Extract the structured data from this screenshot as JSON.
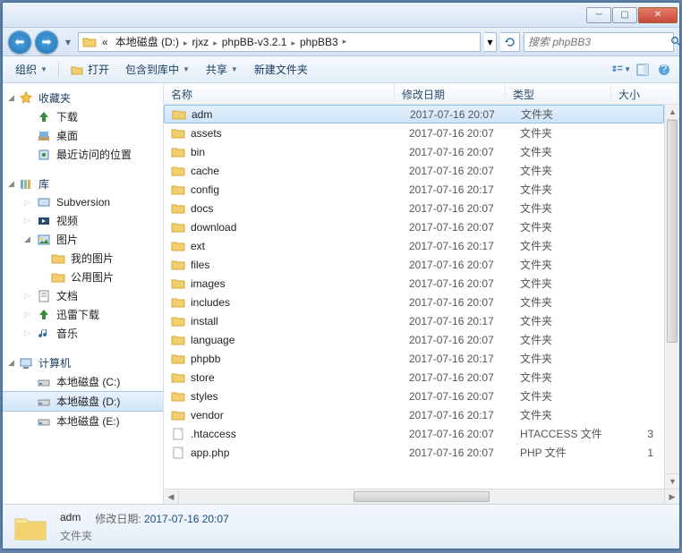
{
  "breadcrumb": {
    "prefix": "«",
    "items": [
      "本地磁盘 (D:)",
      "rjxz",
      "phpBB-v3.2.1",
      "phpBB3"
    ]
  },
  "search": {
    "placeholder": "搜索 phpBB3"
  },
  "toolbar": {
    "organize": "组织",
    "open": "打开",
    "include": "包含到库中",
    "share": "共享",
    "newfolder": "新建文件夹"
  },
  "columns": {
    "name": "名称",
    "date": "修改日期",
    "type": "类型",
    "size": "大小"
  },
  "nav": {
    "favorites": {
      "label": "收藏夹",
      "items": [
        "下载",
        "桌面",
        "最近访问的位置"
      ]
    },
    "libraries": {
      "label": "库",
      "items": [
        {
          "label": "Subversion"
        },
        {
          "label": "视频"
        },
        {
          "label": "图片",
          "children": [
            "我的图片",
            "公用图片"
          ]
        },
        {
          "label": "文档"
        },
        {
          "label": "迅雷下载"
        },
        {
          "label": "音乐"
        }
      ]
    },
    "computer": {
      "label": "计算机",
      "items": [
        "本地磁盘 (C:)",
        "本地磁盘 (D:)",
        "本地磁盘 (E:)"
      ]
    }
  },
  "files": [
    {
      "name": "adm",
      "date": "2017-07-16 20:07",
      "type": "文件夹",
      "kind": "folder",
      "selected": true
    },
    {
      "name": "assets",
      "date": "2017-07-16 20:07",
      "type": "文件夹",
      "kind": "folder"
    },
    {
      "name": "bin",
      "date": "2017-07-16 20:07",
      "type": "文件夹",
      "kind": "folder"
    },
    {
      "name": "cache",
      "date": "2017-07-16 20:07",
      "type": "文件夹",
      "kind": "folder"
    },
    {
      "name": "config",
      "date": "2017-07-16 20:17",
      "type": "文件夹",
      "kind": "folder"
    },
    {
      "name": "docs",
      "date": "2017-07-16 20:07",
      "type": "文件夹",
      "kind": "folder"
    },
    {
      "name": "download",
      "date": "2017-07-16 20:07",
      "type": "文件夹",
      "kind": "folder"
    },
    {
      "name": "ext",
      "date": "2017-07-16 20:17",
      "type": "文件夹",
      "kind": "folder"
    },
    {
      "name": "files",
      "date": "2017-07-16 20:07",
      "type": "文件夹",
      "kind": "folder"
    },
    {
      "name": "images",
      "date": "2017-07-16 20:07",
      "type": "文件夹",
      "kind": "folder"
    },
    {
      "name": "includes",
      "date": "2017-07-16 20:07",
      "type": "文件夹",
      "kind": "folder"
    },
    {
      "name": "install",
      "date": "2017-07-16 20:17",
      "type": "文件夹",
      "kind": "folder"
    },
    {
      "name": "language",
      "date": "2017-07-16 20:07",
      "type": "文件夹",
      "kind": "folder"
    },
    {
      "name": "phpbb",
      "date": "2017-07-16 20:17",
      "type": "文件夹",
      "kind": "folder"
    },
    {
      "name": "store",
      "date": "2017-07-16 20:07",
      "type": "文件夹",
      "kind": "folder"
    },
    {
      "name": "styles",
      "date": "2017-07-16 20:07",
      "type": "文件夹",
      "kind": "folder"
    },
    {
      "name": "vendor",
      "date": "2017-07-16 20:17",
      "type": "文件夹",
      "kind": "folder"
    },
    {
      "name": ".htaccess",
      "date": "2017-07-16 20:07",
      "type": "HTACCESS 文件",
      "kind": "file",
      "size": "3"
    },
    {
      "name": "app.php",
      "date": "2017-07-16 20:07",
      "type": "PHP 文件",
      "kind": "file",
      "size": "1"
    }
  ],
  "details": {
    "name": "adm",
    "date_label": "修改日期:",
    "date": "2017-07-16 20:07",
    "type": "文件夹"
  }
}
